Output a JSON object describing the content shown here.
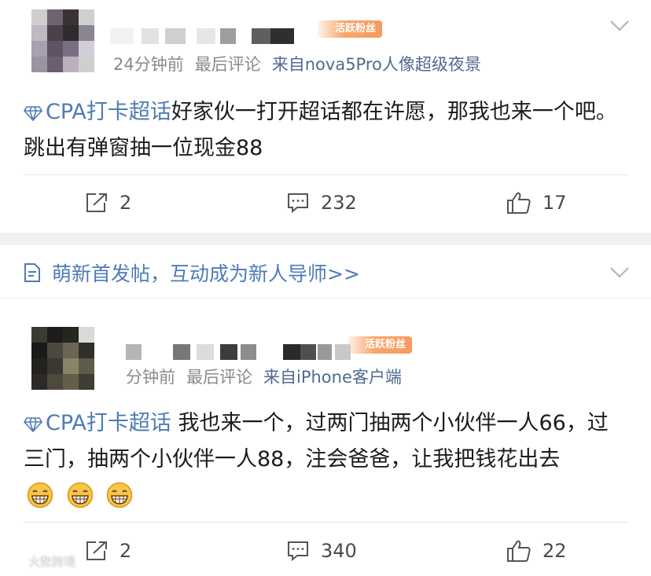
{
  "posts": [
    {
      "fan_badge": "活跃粉丝",
      "meta": {
        "time": "24分钟前",
        "comment_status": "最后评论",
        "source": "来自nova5Pro人像超级夜景"
      },
      "topic": "CPA打卡超话",
      "text": "好家伙一打开超话都在许愿，那我也来一个吧。跳出有弹窗抽一位现金88",
      "actions": {
        "share": "2",
        "comments": "232",
        "likes": "17"
      }
    },
    {
      "fan_badge": "活跃粉丝",
      "meta": {
        "time": "分钟前",
        "comment_status": "最后评论",
        "source": "来自iPhone客户端"
      },
      "topic": "CPA打卡超话",
      "text": " 我也来一个，过两门抽两个小伙伴一人66，过三门，抽两个小伙伴一人88，注会爸爸，让我把钱花出去",
      "actions": {
        "share": "2",
        "comments": "340",
        "likes": "22"
      }
    }
  ],
  "notice": {
    "text": "萌新首发帖，互动成为新人导师>>"
  },
  "watermark": {
    "text": "大数跨境"
  },
  "colors": {
    "link": "#4f7bb4",
    "meta": "#8a8a8a",
    "source": "#506a8f",
    "badge": "#f79a5e",
    "gap": "#f2f2f2"
  },
  "icons": [
    "chevron-down-icon",
    "diamond-topic-icon",
    "share-icon",
    "comment-icon",
    "like-icon",
    "document-icon",
    "grin-emoji-icon"
  ]
}
